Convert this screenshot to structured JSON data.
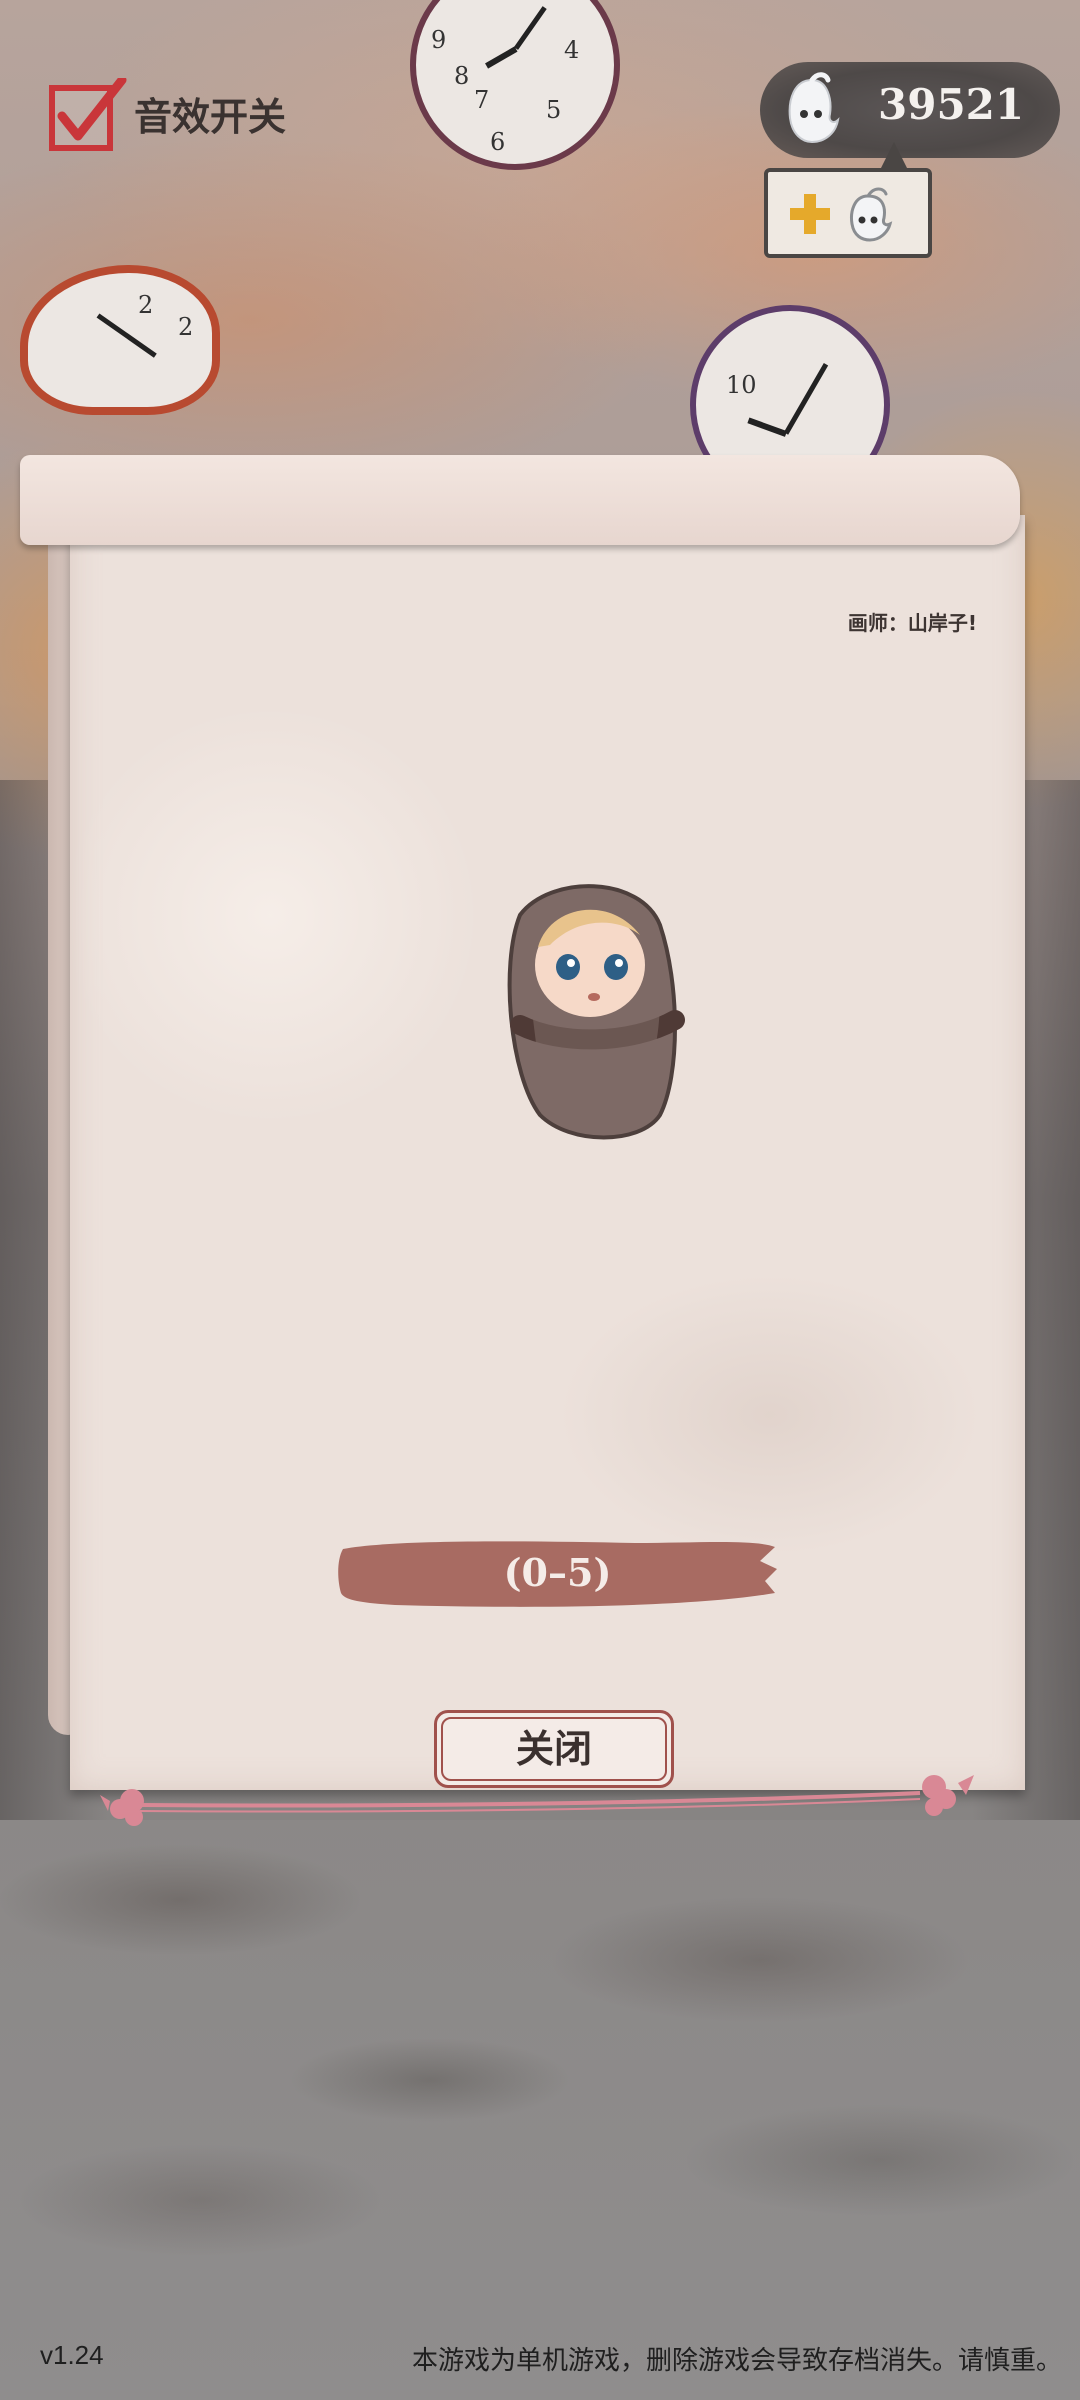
{
  "sound": {
    "label": "音效开关",
    "checked": true
  },
  "currency": {
    "icon": "ghost-icon",
    "value": "39521",
    "add_icon": "plus-ghost-icon"
  },
  "dialog": {
    "artist_credit": "画师：山岸子!",
    "character_icon": "swaddled-baby",
    "range": "(0–5)",
    "close_label": "关闭"
  },
  "footer": {
    "version": "v1.24",
    "notice": "本游戏为单机游戏，删除游戏会导致存档消失。请慎重。"
  },
  "colors": {
    "banner": "#a86b62",
    "accent_red": "#c9363a",
    "divider_pink": "#d98895"
  }
}
